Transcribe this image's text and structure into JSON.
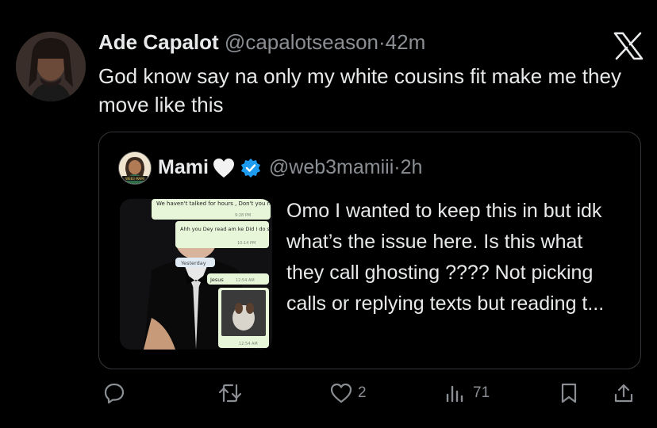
{
  "tweet": {
    "author_name": "Ade Capalot",
    "handle": "@capalotseason",
    "separator": "·",
    "time": "42m",
    "text": "God know say na only my white cousins fit make me they move like this"
  },
  "quote": {
    "author_name": "Mami",
    "handle": "@web3mamiii",
    "separator": "·",
    "time": "2h",
    "text": "Omo I wanted to keep this in but idk what’s the issue here. Is this what they call ghosting ???? Not picking calls or replying texts but reading t...",
    "avatar_label": "WEB3 MAMI",
    "media": {
      "msg_top": "We haven't talked for hours , Don't you miss me??",
      "msg_top_time": "9:28 PM",
      "msg_2": "Ahh you Dey read am ke Did I do something wrong ?",
      "msg_2_time": "10:14 PM",
      "date_chip": "Yesterday",
      "msg_3": "Jesus",
      "msg_3_time": "12:54 AM",
      "msg_4_time": "12:54 AM"
    }
  },
  "actions": {
    "reply_icon": "reply-icon",
    "retweet_icon": "retweet-icon",
    "like_count": "2",
    "views_count": "71",
    "bookmark_icon": "bookmark-icon",
    "share_icon": "share-icon"
  },
  "colors": {
    "background": "#000000",
    "text": "#e7e9ea",
    "muted": "#8b8f94",
    "border": "#33363a",
    "verified": "#1d9bf0"
  }
}
